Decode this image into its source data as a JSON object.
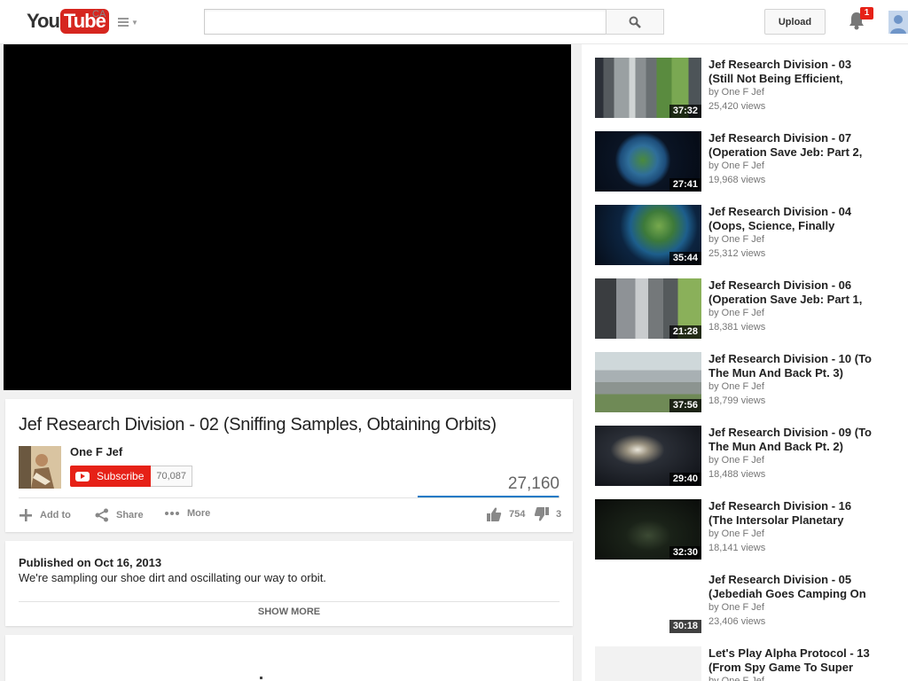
{
  "header": {
    "logo_you": "You",
    "logo_tube": "Tube",
    "region": "CA",
    "search_placeholder": "",
    "upload_label": "Upload",
    "notification_count": "1"
  },
  "video": {
    "title": "Jef Research Division - 02 (Sniffing Samples, Obtaining Orbits)",
    "owner": "One F Jef",
    "subscribe_label": "Subscribe",
    "subscriber_count": "70,087",
    "view_count": "27,160",
    "like_fraction": 0.996,
    "actions": {
      "add_to": "Add to",
      "share": "Share",
      "more": "More"
    },
    "likes": "754",
    "dislikes": "3"
  },
  "description": {
    "published": "Published on Oct 16, 2013",
    "text": "We're sampling our shoe dirt and oscillating our way to orbit.",
    "show_more": "SHOW MORE"
  },
  "related": [
    {
      "title": "Jef Research Division - 03 (Still Not Being Efficient,",
      "by": "by One F Jef",
      "views": "25,420 views",
      "duration": "37:32",
      "thumb": "t-ship"
    },
    {
      "title": "Jef Research Division - 07 (Operation Save Jeb: Part 2,",
      "by": "by One F Jef",
      "views": "19,968 views",
      "duration": "27:41",
      "thumb": "t-earth"
    },
    {
      "title": "Jef Research Division - 04 (Oops, Science, Finally",
      "by": "by One F Jef",
      "views": "25,312 views",
      "duration": "35:44",
      "thumb": "t-earth2"
    },
    {
      "title": "Jef Research Division - 06 (Operation Save Jeb: Part 1,",
      "by": "by One F Jef",
      "views": "18,381 views",
      "duration": "21:28",
      "thumb": "t-tower"
    },
    {
      "title": "Jef Research Division - 10 (To The Mun And Back Pt. 3)",
      "by": "by One F Jef",
      "views": "18,799 views",
      "duration": "37:56",
      "thumb": "t-pad"
    },
    {
      "title": "Jef Research Division - 09 (To The Mun And Back Pt. 2)",
      "by": "by One F Jef",
      "views": "18,488 views",
      "duration": "29:40",
      "thumb": "t-space"
    },
    {
      "title": "Jef Research Division - 16 (The Intersolar Planetary",
      "by": "by One F Jef",
      "views": "18,141 views",
      "duration": "32:30",
      "thumb": "t-orbit"
    },
    {
      "title": "Jef Research Division - 05 (Jebediah Goes Camping On",
      "by": "by One F Jef",
      "views": "23,406 views",
      "duration": "30:18",
      "thumb": "t-blank"
    },
    {
      "title": "Let's Play Alpha Protocol - 13 (From Spy Game To Super",
      "by": "by One F Jef",
      "views": "",
      "duration": "",
      "thumb": "t-last"
    }
  ],
  "colors": {
    "brand_red": "#e62117",
    "like_blue": "#167ac6"
  },
  "icons": {
    "search": "search-icon",
    "bell": "bell-icon",
    "guide": "guide-menu-icon",
    "add": "plus-icon",
    "share": "share-icon",
    "more": "more-dots-icon",
    "like": "thumbs-up-icon",
    "dislike": "thumbs-down-icon"
  }
}
